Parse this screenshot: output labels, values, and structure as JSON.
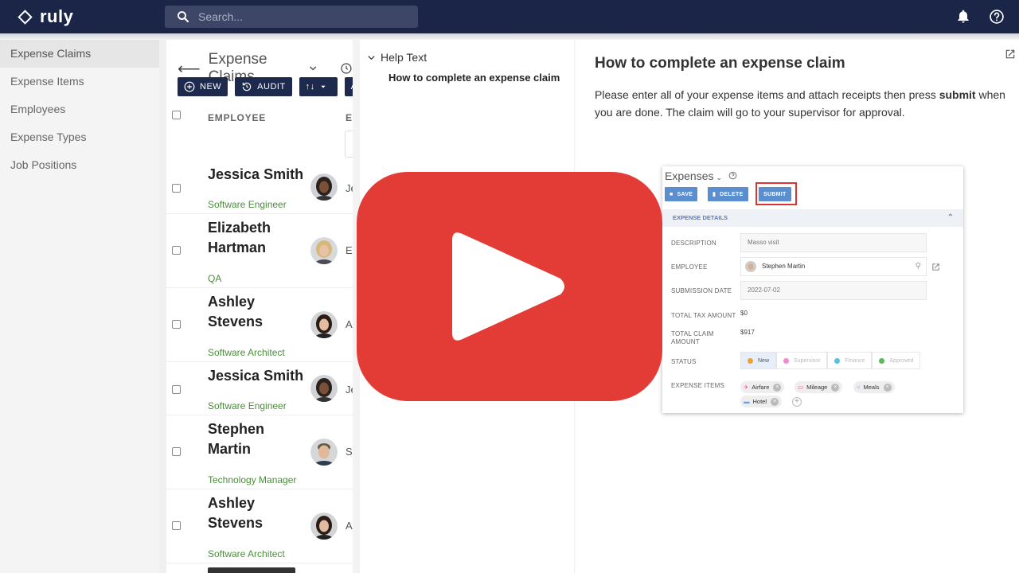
{
  "app": {
    "logo_text": "ruly"
  },
  "search": {
    "placeholder": "Search..."
  },
  "sidebar": {
    "items": [
      {
        "label": "Expense Claims"
      },
      {
        "label": "Expense Items"
      },
      {
        "label": "Employees"
      },
      {
        "label": "Expense Types"
      },
      {
        "label": "Job Positions"
      }
    ]
  },
  "list": {
    "title": "Expense Claims",
    "buttons": {
      "new": "NEW",
      "audit": "AUDIT",
      "sort": "↑↓",
      "more": "A("
    },
    "columns": {
      "employee": "EMPLOYEE",
      "next": "E"
    },
    "rows": [
      {
        "name": "Jessica Smith",
        "role": "Software Engineer",
        "trunc": "Jes"
      },
      {
        "name": "Elizabeth Hartman",
        "role": "QA",
        "trunc": "El"
      },
      {
        "name": "Ashley Stevens",
        "role": "Software Architect",
        "trunc": "As"
      },
      {
        "name": "Jessica Smith",
        "role": "Software Engineer",
        "trunc": "Jes"
      },
      {
        "name": "Stephen Martin",
        "role": "Technology Manager",
        "trunc": "Ste"
      },
      {
        "name": "Ashley Stevens",
        "role": "Software Architect",
        "trunc": "Ash"
      }
    ]
  },
  "help": {
    "heading": "Help Text",
    "item": "How to complete an expense claim"
  },
  "content": {
    "title": "How to complete an expense claim",
    "body_pre": "Please enter all of your expense items and attach receipts then press ",
    "body_bold": "submit",
    "body_post": "  when you are done. The claim will go to your supervisor for approval."
  },
  "screenshot": {
    "title": "Expenses",
    "buttons": {
      "save": "SAVE",
      "delete": "DELETE",
      "submit": "SUBMIT"
    },
    "section": "EXPENSE DETAILS",
    "fields": {
      "description_label": "DESCRIPTION",
      "description_value": "Masso visit",
      "employee_label": "EMPLOYEE",
      "employee_value": "Stephen Martin",
      "submission_label": "SUBMISSION DATE",
      "submission_value": "2022-07-02",
      "tax_label": "TOTAL TAX AMOUNT",
      "tax_value": "$0",
      "claim_label_1": "TOTAL CLAIM",
      "claim_label_2": "AMOUNT",
      "claim_value": "$917",
      "status_label": "STATUS",
      "items_label": "EXPENSE ITEMS"
    },
    "status": [
      {
        "label": "New",
        "color": "#f0a030"
      },
      {
        "label": "Supervisor",
        "color": "#f08ad0"
      },
      {
        "label": "Finance",
        "color": "#5bc0de"
      },
      {
        "label": "Approved",
        "color": "#5cb85c"
      }
    ],
    "items": [
      "Airfare",
      "Mileage",
      "Meals",
      "Hotel"
    ]
  },
  "colors": {
    "topbar": "#1b2547",
    "play": "#e33b35",
    "role_green": "#4a8f3a",
    "button_blue": "#5b8ecf"
  }
}
